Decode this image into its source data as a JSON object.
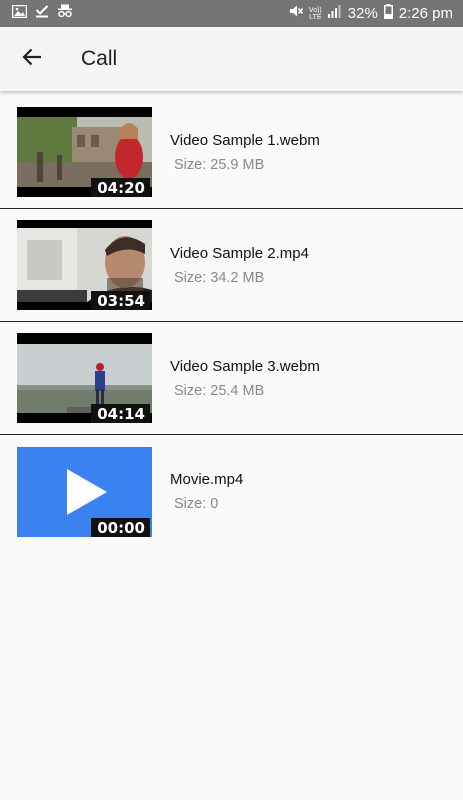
{
  "status_bar": {
    "battery": "32%",
    "time": "2:26 pm",
    "volte_top": "Vo))",
    "volte_bottom": "LTE",
    "icons": [
      "gallery-icon",
      "download-done-icon",
      "incognito-icon",
      "mute-icon",
      "signal-icon",
      "battery-icon"
    ]
  },
  "app_bar": {
    "title": "Call",
    "back_icon": "arrow-back-icon"
  },
  "videos": [
    {
      "name": "Video Sample 1.webm",
      "size": "Size: 25.9 MB",
      "duration": "04:20"
    },
    {
      "name": "Video Sample 2.mp4",
      "size": "Size: 34.2 MB",
      "duration": "03:54"
    },
    {
      "name": "Video Sample 3.webm",
      "size": "Size: 25.4 MB",
      "duration": "04:14"
    },
    {
      "name": "Movie.mp4",
      "size": "Size: 0",
      "duration": "00:00"
    }
  ],
  "colors": {
    "status_bar": "#757575",
    "app_bar": "#f5f5f5",
    "placeholder_thumb": "#3b82f1",
    "size_text": "#8a8a80"
  }
}
